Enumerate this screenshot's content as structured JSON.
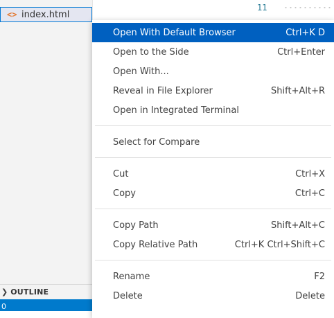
{
  "explorer": {
    "file": {
      "icon": "html-file-icon",
      "icon_glyph": "<>",
      "name": "index.html"
    },
    "outline": {
      "label": "OUTLINE"
    },
    "status": {
      "text": "0"
    }
  },
  "editor": {
    "line_number": "11"
  },
  "context_menu": {
    "groups": [
      [
        {
          "label": "Open With Default Browser",
          "shortcut": "Ctrl+K D",
          "highlighted": true
        },
        {
          "label": "Open to the Side",
          "shortcut": "Ctrl+Enter"
        },
        {
          "label": "Open With...",
          "shortcut": ""
        },
        {
          "label": "Reveal in File Explorer",
          "shortcut": "Shift+Alt+R"
        },
        {
          "label": "Open in Integrated Terminal",
          "shortcut": ""
        }
      ],
      [
        {
          "label": "Select for Compare",
          "shortcut": ""
        }
      ],
      [
        {
          "label": "Cut",
          "shortcut": "Ctrl+X"
        },
        {
          "label": "Copy",
          "shortcut": "Ctrl+C"
        }
      ],
      [
        {
          "label": "Copy Path",
          "shortcut": "Shift+Alt+C"
        },
        {
          "label": "Copy Relative Path",
          "shortcut": "Ctrl+K Ctrl+Shift+C"
        }
      ],
      [
        {
          "label": "Rename",
          "shortcut": "F2"
        },
        {
          "label": "Delete",
          "shortcut": "Delete"
        }
      ]
    ]
  },
  "colors": {
    "accent": "#0060c0",
    "status_bar": "#007acc",
    "html_icon": "#e37933"
  }
}
